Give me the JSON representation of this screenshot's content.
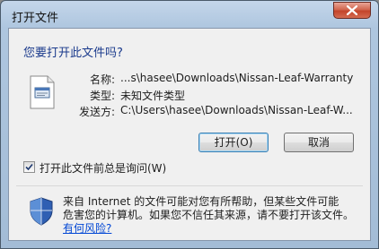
{
  "window": {
    "title": "打开文件",
    "close_icon": "close-icon"
  },
  "dialog": {
    "question": "您要打开此文件吗?",
    "file_icon": "file-icon",
    "fields": [
      {
        "label": "名称:",
        "value": "...s\\hasee\\Downloads\\Nissan-Leaf-Warranty"
      },
      {
        "label": "类型:",
        "value": "未知文件类型"
      },
      {
        "label": "发送方:",
        "value": "C:\\Users\\hasee\\Downloads\\Nissan-Leaf-W..."
      }
    ],
    "open_button": "打开(O)",
    "cancel_button": "取消",
    "checkbox": {
      "label": "打开此文件前总是询问(W)",
      "checked": true
    }
  },
  "warning": {
    "icon": "shield-icon",
    "line1": "来自 Internet 的文件可能对您有所帮助，但某些文件可能",
    "line2": "危害您的计算机。如果您不信任其来源，请不要打开该文件。",
    "link": "有何风险?"
  }
}
